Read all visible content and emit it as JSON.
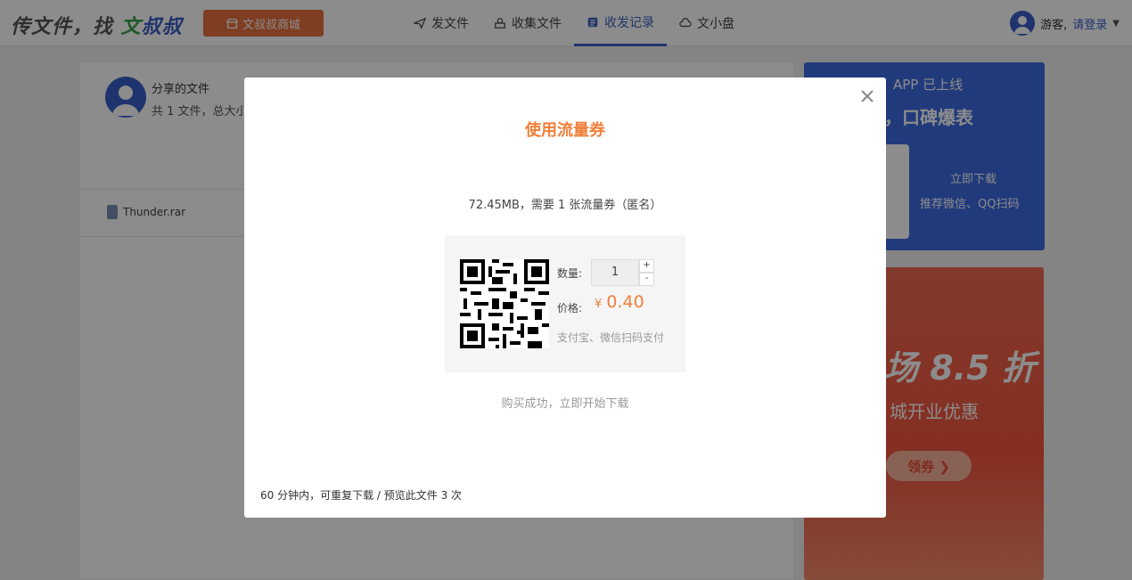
{
  "header": {
    "logo": {
      "part1": "传文件，找 ",
      "part2": "文",
      "part3": "叔叔"
    },
    "shop_button": "文叔叔商城",
    "nav": [
      {
        "label": "发文件",
        "icon": "send-icon"
      },
      {
        "label": "收集文件",
        "icon": "collect-icon"
      },
      {
        "label": "收发记录",
        "icon": "record-icon",
        "active": true
      },
      {
        "label": "文小盘",
        "icon": "cloud-icon"
      }
    ],
    "user": {
      "guest": "游客,",
      "login": "请登录"
    }
  },
  "share": {
    "title": "分享的文件",
    "subtitle": "共 1 文件，总大小",
    "file_name": "Thunder.rar"
  },
  "ads": {
    "app": {
      "line1": "APP 已上线",
      "line2": "速，口碑爆表",
      "download": "立即下载",
      "hint": "推荐微信、QQ扫码"
    },
    "promo": {
      "big": "场 8.5 折",
      "sub": "城开业优惠",
      "button": "领券 ❯"
    }
  },
  "modal": {
    "title": "使用流量券",
    "description": "72.45MB，需要 1 张流量券（匿名）",
    "quantity_label": "数量:",
    "quantity_value": "1",
    "plus": "+",
    "minus": "-",
    "price_label": "价格:",
    "currency": "¥",
    "price": "0.40",
    "pay_methods": "支付宝、微信扫码支付",
    "success_text": "购买成功，立即开始下载",
    "footer_note": "60 分钟内，可重复下载 / 预览此文件 3 次"
  },
  "colors": {
    "brand_blue": "#3f63c4",
    "accent_orange": "#f07f3a",
    "shop_orange": "#e8703e"
  }
}
